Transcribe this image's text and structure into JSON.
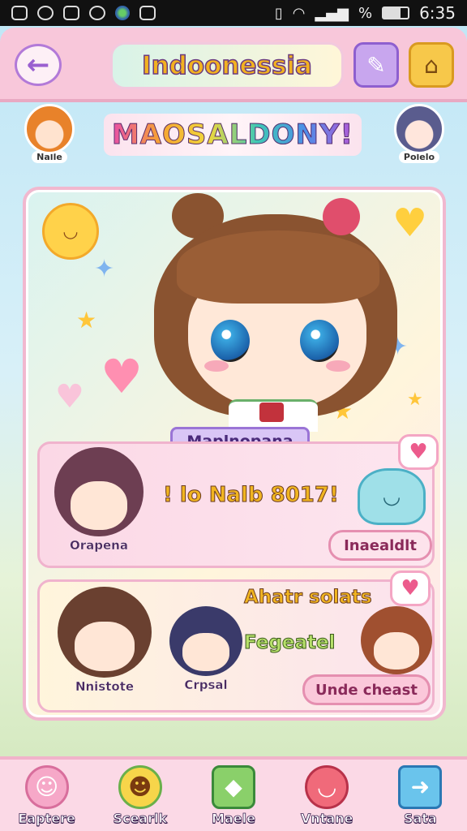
{
  "status_bar": {
    "time": "6:35",
    "signal_text": "%"
  },
  "header": {
    "title": "Indoonessia",
    "back_icon": "back-arrow-icon",
    "edit_icon": "brush-icon",
    "home_icon": "home-icon"
  },
  "banner": {
    "text": "MAOSALDONY!",
    "left_avatar_label": "Nalle",
    "right_avatar_label": "Polelo"
  },
  "hero": {
    "name": "Maplnopana"
  },
  "card_1": {
    "character_label": "Orapena",
    "message": "! lo Nalb 8017!",
    "button_label": "Inaealdlt"
  },
  "card_2": {
    "character_left_label": "Nnistote",
    "character_mid_label": "Crpsal",
    "line_1": "Ahatr solats",
    "line_2": "Fegeatel",
    "button_label": "Unde cheast"
  },
  "bottom_nav": {
    "items": [
      {
        "label": "Eaptere",
        "icon": "girl-avatar-icon"
      },
      {
        "label": "Scearlk",
        "icon": "character-scout-icon"
      },
      {
        "label": "Maele",
        "icon": "green-gem-icon"
      },
      {
        "label": "Vntane",
        "icon": "chat-bubble-icon"
      },
      {
        "label": "Sata",
        "icon": "save-arrow-icon"
      }
    ]
  }
}
